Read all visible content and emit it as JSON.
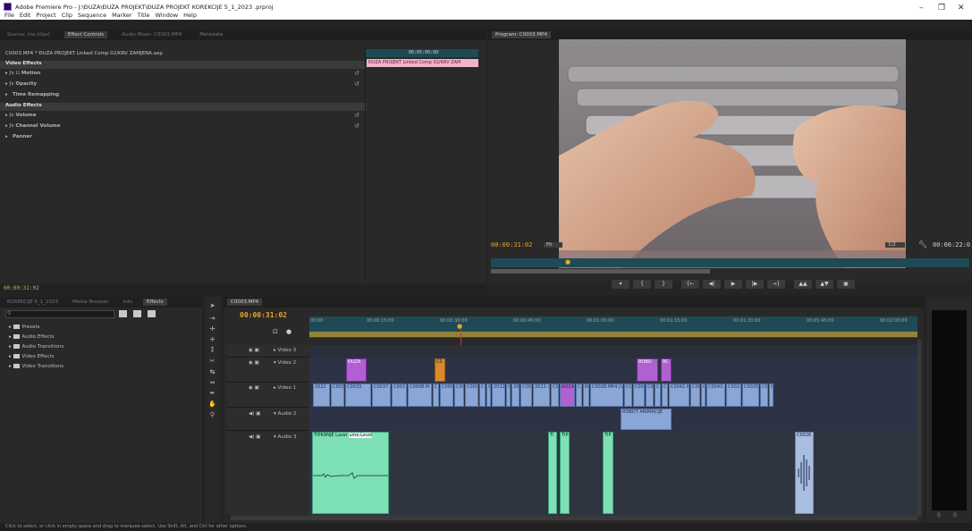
{
  "app": {
    "title": "Adobe Premiere Pro - J:\\ĐUZA\\ĐUZA PROJEKT\\ĐUZA PROJEKT KOREKCIJE 5_1_2023 .prproj",
    "menu": [
      "File",
      "Edit",
      "Project",
      "Clip",
      "Sequence",
      "Marker",
      "Title",
      "Window",
      "Help"
    ],
    "window_controls": {
      "minimize": "–",
      "maximize": "❐",
      "close": "✕"
    }
  },
  "source_panel": {
    "tabs": [
      "Source: (no clips)",
      "Effect Controls",
      "Audio Mixer: C0003.MP4",
      "Metadata"
    ],
    "active_tab": 1,
    "clip_header": "C0003.MP4 * ĐUZA PROJEKT Linked Comp 02/KRV ZAMJENA.aep",
    "mini_timecode": "00:05:00:00",
    "mini_clip_label": "ĐUZA PROJEKT Linked Comp 02/KRV ZAM",
    "video_effects_label": "Video Effects",
    "video_effects": [
      "Motion",
      "Opacity",
      "Time Remapping"
    ],
    "audio_effects_label": "Audio Effects",
    "audio_effects": [
      "Volume",
      "Channel Volume",
      "Panner"
    ],
    "timecode": "00:00:31:02"
  },
  "program_monitor": {
    "tab": "Program: C0003.MP4",
    "timecode": "00:00:31:02",
    "fit": "Fit",
    "resolution": "1/2",
    "duration": "00:06:22:0"
  },
  "project_panel": {
    "tabs": [
      "KOREKCIJE 5_1_2023",
      "Media Browser",
      "Info",
      "Effects",
      "Markers"
    ],
    "active_tab": 3,
    "search_placeholder": "",
    "items": [
      "Presets",
      "Audio Effects",
      "Audio Transitions",
      "Video Effects",
      "Video Transitions"
    ]
  },
  "timeline": {
    "tab": "C0003.MP4",
    "timecode": "00:00:31:02",
    "ruler": [
      "00:00",
      "00:00:15:00",
      "00:00:30:00",
      "00:00:45:00",
      "00:01:00:00",
      "00:01:15:00",
      "00:01:30:00",
      "00:01:45:00",
      "00:02:00:00"
    ],
    "tracks": [
      {
        "name": "Video 3",
        "kind": "video"
      },
      {
        "name": "Video 2",
        "kind": "video"
      },
      {
        "name": "Video 1",
        "kind": "video"
      },
      {
        "name": "Audio 2",
        "kind": "audio"
      },
      {
        "name": "Audio 3",
        "kind": "audio"
      }
    ],
    "clips": {
      "v2_a": "ĐUZA",
      "v2_b": "C0",
      "v2_c": "ROBO",
      "v2_d": "RC",
      "v1": [
        "2022",
        "C003",
        "C0033.",
        "C0037.M",
        "C003",
        "C0008.M",
        "C",
        "C0005",
        "C00",
        "C0005",
        "CC",
        "C",
        "2022",
        "C",
        "202",
        "C003",
        "2022-1",
        "C00",
        "ROZA",
        "C",
        "RC",
        "C0028.MP4 [V]",
        "CO",
        "C00",
        "C00",
        "C",
        "C",
        "C0042.M",
        "C00",
        "C",
        "C0043.M",
        "C002",
        "C0025.M",
        "C0C",
        "C"
      ],
      "a2": "ROBOT ANIMACIJE",
      "a3_a": "TIPKANJE Laser",
      "a3_a2": "ume:Level",
      "a3_b": "Ti",
      "a3_c": "TIP",
      "a3_d": "TIP",
      "a3_e": "C0026"
    }
  },
  "status": "Click to select, or click in empty space and drag to marquee select. Use Shift, Alt, and Ctrl for other options."
}
